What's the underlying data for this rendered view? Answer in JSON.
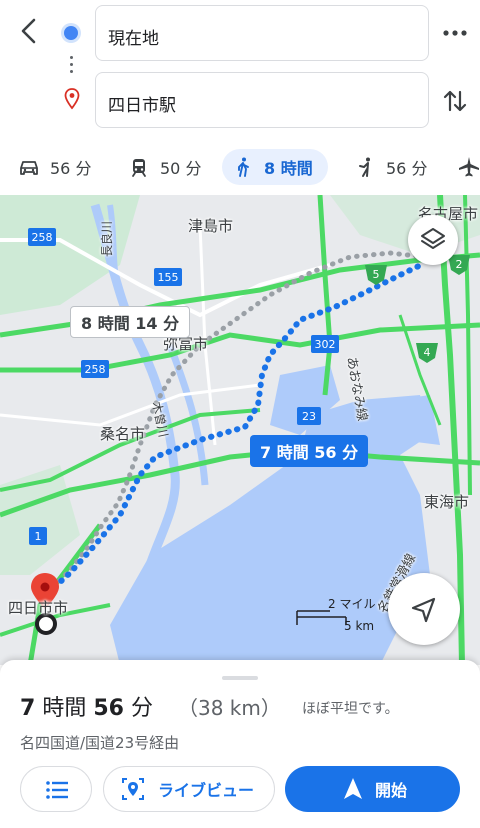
{
  "search": {
    "origin_value": "現在地",
    "destination_value": "四日市駅"
  },
  "modes": [
    {
      "icon": "car-icon",
      "label": "56 分"
    },
    {
      "icon": "train-icon",
      "label": "50 分"
    },
    {
      "icon": "walk-icon",
      "label": "8 時間",
      "selected": true
    },
    {
      "icon": "rideshare-icon",
      "label": "56 分"
    },
    {
      "icon": "flight-icon",
      "label": ""
    }
  ],
  "map": {
    "labels": {
      "nagoya": "名古屋市",
      "tsushima": "津島市",
      "yatomi": "弥富市",
      "kuwana": "桑名市",
      "tokai": "東海市",
      "yokkaichi": "四日市市",
      "aonami_line": "あおなみ線",
      "kisogawa": "木曽川",
      "nagaragawa": "長良川",
      "railway_line": "名鉄常滑線"
    },
    "road_shields": [
      "258",
      "155",
      "302",
      "23",
      "258",
      "1",
      "5",
      "2",
      "4"
    ],
    "route_callouts": {
      "alternate": "8 時間 14 分",
      "selected": "7 時間 56 分"
    },
    "scale": {
      "miles": "2 マイル",
      "km": "5 km"
    },
    "colors": {
      "water": "#aecbfa",
      "land": "#e8eaed",
      "park": "#ceead6",
      "highway": "#4cd964",
      "route": "#4285f4",
      "alt_route": "#9aa0a6"
    }
  },
  "sheet": {
    "eta_hours": "7",
    "eta_hours_unit": "時間",
    "eta_minutes": "56",
    "eta_minutes_unit": "分",
    "distance": "（38 km）",
    "terrain": "ほぼ平坦です。",
    "via": "名四国道/国道23号経由",
    "live_view_label": "ライブビュー",
    "start_label": "開始"
  }
}
